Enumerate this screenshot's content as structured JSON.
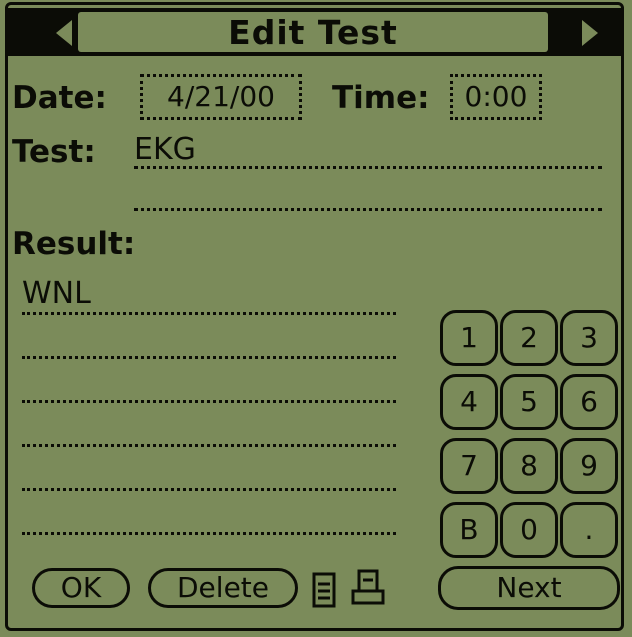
{
  "title": "Edit Test",
  "date_label": "Date:",
  "date_value": "4/21/00",
  "time_label": "Time:",
  "time_value": "0:00",
  "test_label": "Test:",
  "test_value": "EKG",
  "result_label": "Result:",
  "result_value": "WNL",
  "keypad": [
    "1",
    "2",
    "3",
    "4",
    "5",
    "6",
    "7",
    "8",
    "9",
    "B",
    "0",
    "."
  ],
  "buttons": {
    "ok": "OK",
    "delete": "Delete",
    "next": "Next"
  },
  "icons": {
    "note": "note-icon",
    "print": "printer-icon",
    "prev": "arrow-left-icon",
    "next": "arrow-right-icon"
  },
  "colors": {
    "screen": "#7b8b5a",
    "ink": "#0b0c06"
  }
}
